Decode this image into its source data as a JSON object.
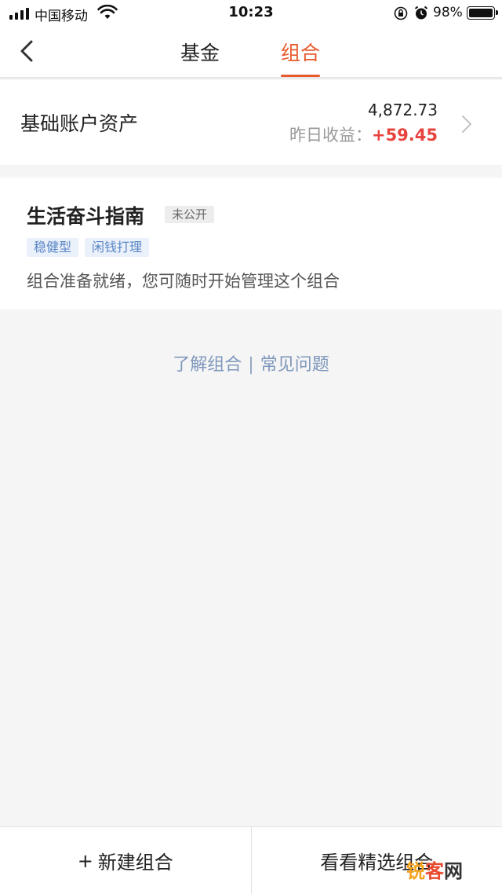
{
  "status_bar": {
    "carrier": "中国移动",
    "time": "10:23",
    "battery_pct": "98%",
    "battery_level": 0.98,
    "icons": [
      "signal-icon",
      "wifi-icon",
      "rotation-lock-icon",
      "alarm-icon",
      "battery-icon"
    ]
  },
  "nav": {
    "tabs": [
      {
        "label": "基金",
        "active": false
      },
      {
        "label": "组合",
        "active": true
      }
    ],
    "accent_color": "#e85a2c"
  },
  "assets": {
    "label": "基础账户资产",
    "amount": "4,872.73",
    "yesterday_label": "昨日收益：",
    "yesterday_value": "+59.45",
    "gain_color": "#e8423c"
  },
  "portfolio": {
    "name": "生活奋斗指南",
    "visibility": "未公开",
    "tags": [
      "稳健型",
      "闲钱打理"
    ],
    "description": "组合准备就绪，您可随时开始管理这个组合"
  },
  "links": {
    "learn": "了解组合",
    "separator": "|",
    "faq": "常见问题"
  },
  "bottom": {
    "new_plus": "+",
    "new_label": "新建组合",
    "featured_label": "看看精选组合"
  },
  "watermark": {
    "part1": "锐",
    "part2": "客",
    "part3": "网"
  }
}
